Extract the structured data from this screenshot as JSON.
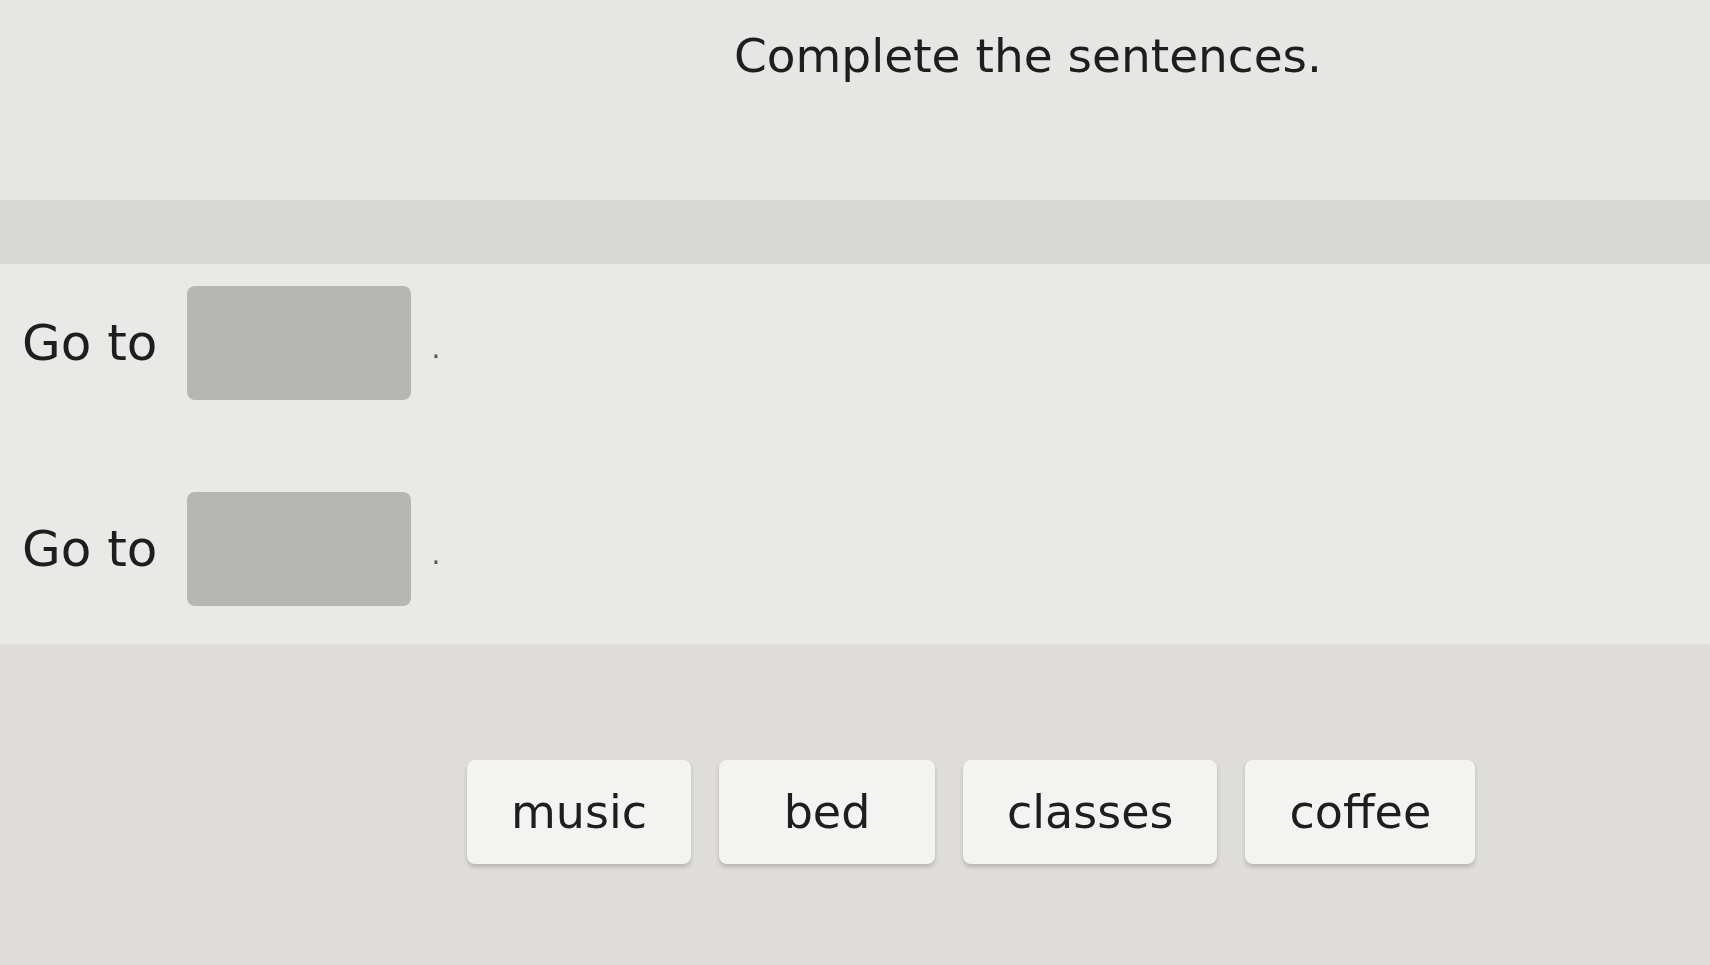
{
  "title": "Complete the sentences.",
  "sentences": [
    {
      "before": "Go to",
      "after": "."
    },
    {
      "before": "Go to",
      "after": "."
    }
  ],
  "word_bank": [
    {
      "label": "music"
    },
    {
      "label": "bed"
    },
    {
      "label": "classes"
    },
    {
      "label": "coffee"
    }
  ]
}
